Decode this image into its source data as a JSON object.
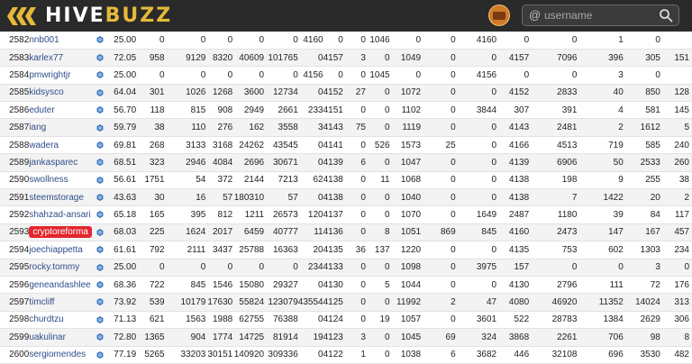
{
  "header": {
    "brand_part1": "HIVE",
    "brand_part2": "BUZZ",
    "search": {
      "prefix": "@",
      "placeholder": "username"
    },
    "colors": {
      "bar": "#2a2a2a",
      "brand_gold": "#e5b93a",
      "highlight": "#e3262e",
      "link": "#2f4e8a"
    },
    "icons": [
      "hive-logo-icon",
      "user-avatar-icon",
      "search-icon",
      "hive-token-icon"
    ]
  },
  "rows": [
    {
      "rank": "2582",
      "name": "nnb001",
      "v": [
        "25.00",
        "0",
        "0",
        "0",
        "0",
        "0",
        "4160",
        "0",
        "0",
        "1046",
        "0",
        "0",
        "4160",
        "0",
        "0",
        "1",
        "0"
      ]
    },
    {
      "rank": "2583",
      "name": "karlex77",
      "v": [
        "72.05",
        "958",
        "9129",
        "8320",
        "40609",
        "101765",
        "0",
        "4157",
        "3",
        "0",
        "1049",
        "0",
        "0",
        "4157",
        "7096",
        "396",
        "305",
        "151"
      ]
    },
    {
      "rank": "2584",
      "name": "pmwrightjr",
      "v": [
        "25.00",
        "0",
        "0",
        "0",
        "0",
        "0",
        "4156",
        "0",
        "0",
        "1045",
        "0",
        "0",
        "4156",
        "0",
        "0",
        "3",
        "0"
      ]
    },
    {
      "rank": "2585",
      "name": "kidsysco",
      "v": [
        "64.04",
        "301",
        "1026",
        "1268",
        "3600",
        "12734",
        "0",
        "4152",
        "27",
        "0",
        "1072",
        "0",
        "0",
        "4152",
        "2833",
        "40",
        "850",
        "128"
      ]
    },
    {
      "rank": "2586",
      "name": "eduter",
      "v": [
        "56.70",
        "118",
        "815",
        "908",
        "2949",
        "2661",
        "233",
        "4151",
        "0",
        "0",
        "1102",
        "0",
        "3844",
        "307",
        "391",
        "4",
        "581",
        "145"
      ]
    },
    {
      "rank": "2587",
      "name": "iang",
      "v": [
        "59.79",
        "38",
        "110",
        "276",
        "162",
        "3558",
        "3",
        "4143",
        "75",
        "0",
        "1119",
        "0",
        "0",
        "4143",
        "2481",
        "2",
        "1612",
        "5"
      ]
    },
    {
      "rank": "2588",
      "name": "wadera",
      "v": [
        "69.81",
        "268",
        "3133",
        "3168",
        "24262",
        "43545",
        "0",
        "4141",
        "0",
        "526",
        "1573",
        "25",
        "0",
        "4166",
        "4513",
        "719",
        "585",
        "240"
      ]
    },
    {
      "rank": "2589",
      "name": "jankasparec",
      "v": [
        "68.51",
        "323",
        "2946",
        "4084",
        "2696",
        "30671",
        "0",
        "4139",
        "6",
        "0",
        "1047",
        "0",
        "0",
        "4139",
        "6906",
        "50",
        "2533",
        "260"
      ]
    },
    {
      "rank": "2590",
      "name": "swollness",
      "v": [
        "56.61",
        "1751",
        "54",
        "372",
        "2144",
        "7213",
        "62",
        "4138",
        "0",
        "11",
        "1068",
        "0",
        "0",
        "4138",
        "198",
        "9",
        "255",
        "38"
      ]
    },
    {
      "rank": "2591",
      "name": "steemstorage",
      "v": [
        "43.63",
        "30",
        "16",
        "57",
        "180310",
        "57",
        "0",
        "4138",
        "0",
        "0",
        "1040",
        "0",
        "0",
        "4138",
        "7",
        "1422",
        "20",
        "2"
      ]
    },
    {
      "rank": "2592",
      "name": "shahzad-ansari",
      "v": [
        "65.18",
        "165",
        "395",
        "812",
        "1211",
        "26573",
        "120",
        "4137",
        "0",
        "0",
        "1070",
        "0",
        "1649",
        "2487",
        "1180",
        "39",
        "84",
        "117"
      ]
    },
    {
      "rank": "2593",
      "name": "cryptoreforma",
      "hl": true,
      "v": [
        "68.03",
        "225",
        "1624",
        "2017",
        "6459",
        "40777",
        "11",
        "4136",
        "0",
        "8",
        "1051",
        "869",
        "845",
        "4160",
        "2473",
        "147",
        "167",
        "457"
      ]
    },
    {
      "rank": "2594",
      "name": "joechiappetta",
      "v": [
        "61.61",
        "792",
        "2111",
        "3437",
        "25788",
        "16363",
        "20",
        "4135",
        "36",
        "137",
        "1220",
        "0",
        "0",
        "4135",
        "753",
        "602",
        "1303",
        "234"
      ]
    },
    {
      "rank": "2595",
      "name": "rocky.tommy",
      "v": [
        "25.00",
        "0",
        "0",
        "0",
        "0",
        "0",
        "234",
        "4133",
        "0",
        "0",
        "1098",
        "0",
        "3975",
        "157",
        "0",
        "0",
        "3",
        "0"
      ]
    },
    {
      "rank": "2596",
      "name": "geneandashlee",
      "v": [
        "68.36",
        "722",
        "845",
        "1546",
        "15080",
        "29327",
        "0",
        "4130",
        "0",
        "5",
        "1044",
        "0",
        "0",
        "4130",
        "2796",
        "111",
        "72",
        "176"
      ]
    },
    {
      "rank": "2597",
      "name": "timcliff",
      "v": [
        "73.92",
        "539",
        "10179",
        "17630",
        "55824",
        "123079",
        "43554",
        "4125",
        "0",
        "0",
        "11992",
        "2",
        "47",
        "4080",
        "46920",
        "11352",
        "14024",
        "313"
      ]
    },
    {
      "rank": "2598",
      "name": "churdtzu",
      "v": [
        "71.13",
        "621",
        "1563",
        "1988",
        "62755",
        "76388",
        "0",
        "4124",
        "0",
        "19",
        "1057",
        "0",
        "3601",
        "522",
        "28783",
        "1384",
        "2629",
        "306"
      ]
    },
    {
      "rank": "2599",
      "name": "uakulinar",
      "v": [
        "72.80",
        "1365",
        "904",
        "1774",
        "14725",
        "81914",
        "19",
        "4123",
        "3",
        "0",
        "1045",
        "69",
        "324",
        "3868",
        "2261",
        "706",
        "98",
        "8"
      ]
    },
    {
      "rank": "2600",
      "name": "sergiomendes",
      "v": [
        "77.19",
        "5265",
        "33203",
        "30151",
        "140920",
        "309336",
        "0",
        "4122",
        "1",
        "0",
        "1038",
        "6",
        "3682",
        "446",
        "32108",
        "696",
        "3530",
        "482"
      ]
    }
  ]
}
